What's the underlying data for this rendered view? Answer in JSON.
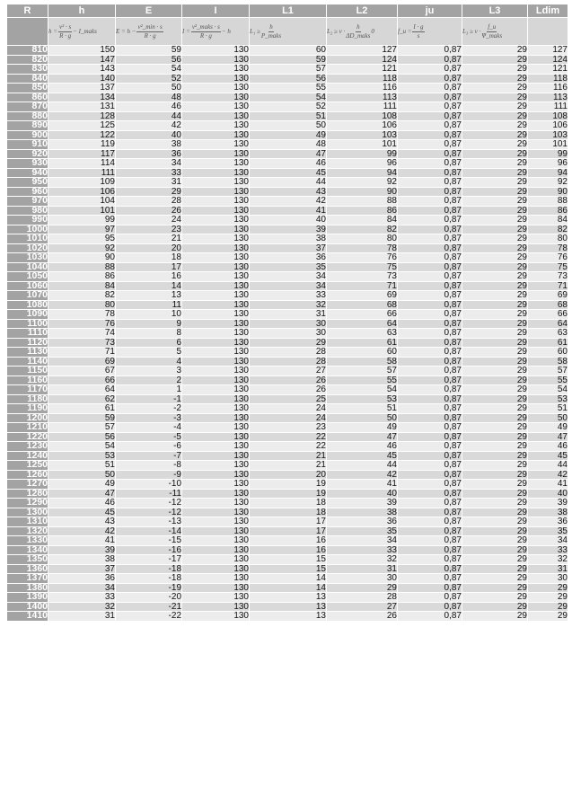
{
  "columns": [
    "R",
    "h",
    "E",
    "I",
    "L1",
    "L2",
    "ju",
    "L3",
    "Ldim"
  ],
  "formulas": {
    "h": {
      "lhs": "h =",
      "num": "v² · s",
      "den": "R · g",
      "rhs": "− I_maks"
    },
    "E": {
      "lhs": "E = h −",
      "num": "v²_min · s",
      "den": "R · g",
      "rhs": ""
    },
    "I": {
      "lhs": "I =",
      "num": "v²_maks · s",
      "den": "R · g",
      "rhs": "− h"
    },
    "L1": {
      "lhs": "L₁ ≥",
      "num": "h",
      "den": "P_maks",
      "rhs": ""
    },
    "L2": {
      "lhs": "L₂ ≥ v ·",
      "num": "h",
      "den": "ΔD_maks",
      "rhs": "0"
    },
    "ju": {
      "lhs": "f_u =",
      "num": "I · g",
      "den": "s",
      "rhs": ""
    },
    "L3": {
      "lhs": "L₃ ≥ v ·",
      "num": "f_u",
      "den": "Ψ_maks",
      "rhs": ""
    },
    "Ldim": null
  },
  "rows": [
    [
      "810",
      "150",
      "59",
      "130",
      "60",
      "127",
      "0,87",
      "29",
      "127"
    ],
    [
      "820",
      "147",
      "56",
      "130",
      "59",
      "124",
      "0,87",
      "29",
      "124"
    ],
    [
      "830",
      "143",
      "54",
      "130",
      "57",
      "121",
      "0,87",
      "29",
      "121"
    ],
    [
      "840",
      "140",
      "52",
      "130",
      "56",
      "118",
      "0,87",
      "29",
      "118"
    ],
    [
      "850",
      "137",
      "50",
      "130",
      "55",
      "116",
      "0,87",
      "29",
      "116"
    ],
    [
      "860",
      "134",
      "48",
      "130",
      "54",
      "113",
      "0,87",
      "29",
      "113"
    ],
    [
      "870",
      "131",
      "46",
      "130",
      "52",
      "111",
      "0,87",
      "29",
      "111"
    ],
    [
      "880",
      "128",
      "44",
      "130",
      "51",
      "108",
      "0,87",
      "29",
      "108"
    ],
    [
      "890",
      "125",
      "42",
      "130",
      "50",
      "106",
      "0,87",
      "29",
      "106"
    ],
    [
      "900",
      "122",
      "40",
      "130",
      "49",
      "103",
      "0,87",
      "29",
      "103"
    ],
    [
      "910",
      "119",
      "38",
      "130",
      "48",
      "101",
      "0,87",
      "29",
      "101"
    ],
    [
      "920",
      "117",
      "36",
      "130",
      "47",
      "99",
      "0,87",
      "29",
      "99"
    ],
    [
      "930",
      "114",
      "34",
      "130",
      "46",
      "96",
      "0,87",
      "29",
      "96"
    ],
    [
      "940",
      "111",
      "33",
      "130",
      "45",
      "94",
      "0,87",
      "29",
      "94"
    ],
    [
      "950",
      "109",
      "31",
      "130",
      "44",
      "92",
      "0,87",
      "29",
      "92"
    ],
    [
      "960",
      "106",
      "29",
      "130",
      "43",
      "90",
      "0,87",
      "29",
      "90"
    ],
    [
      "970",
      "104",
      "28",
      "130",
      "42",
      "88",
      "0,87",
      "29",
      "88"
    ],
    [
      "980",
      "101",
      "26",
      "130",
      "41",
      "86",
      "0,87",
      "29",
      "86"
    ],
    [
      "990",
      "99",
      "24",
      "130",
      "40",
      "84",
      "0,87",
      "29",
      "84"
    ],
    [
      "1000",
      "97",
      "23",
      "130",
      "39",
      "82",
      "0,87",
      "29",
      "82"
    ],
    [
      "1010",
      "95",
      "21",
      "130",
      "38",
      "80",
      "0,87",
      "29",
      "80"
    ],
    [
      "1020",
      "92",
      "20",
      "130",
      "37",
      "78",
      "0,87",
      "29",
      "78"
    ],
    [
      "1030",
      "90",
      "18",
      "130",
      "36",
      "76",
      "0,87",
      "29",
      "76"
    ],
    [
      "1040",
      "88",
      "17",
      "130",
      "35",
      "75",
      "0,87",
      "29",
      "75"
    ],
    [
      "1050",
      "86",
      "16",
      "130",
      "34",
      "73",
      "0,87",
      "29",
      "73"
    ],
    [
      "1060",
      "84",
      "14",
      "130",
      "34",
      "71",
      "0,87",
      "29",
      "71"
    ],
    [
      "1070",
      "82",
      "13",
      "130",
      "33",
      "69",
      "0,87",
      "29",
      "69"
    ],
    [
      "1080",
      "80",
      "11",
      "130",
      "32",
      "68",
      "0,87",
      "29",
      "68"
    ],
    [
      "1090",
      "78",
      "10",
      "130",
      "31",
      "66",
      "0,87",
      "29",
      "66"
    ],
    [
      "1100",
      "76",
      "9",
      "130",
      "30",
      "64",
      "0,87",
      "29",
      "64"
    ],
    [
      "1110",
      "74",
      "8",
      "130",
      "30",
      "63",
      "0,87",
      "29",
      "63"
    ],
    [
      "1120",
      "73",
      "6",
      "130",
      "29",
      "61",
      "0,87",
      "29",
      "61"
    ],
    [
      "1130",
      "71",
      "5",
      "130",
      "28",
      "60",
      "0,87",
      "29",
      "60"
    ],
    [
      "1140",
      "69",
      "4",
      "130",
      "28",
      "58",
      "0,87",
      "29",
      "58"
    ],
    [
      "1150",
      "67",
      "3",
      "130",
      "27",
      "57",
      "0,87",
      "29",
      "57"
    ],
    [
      "1160",
      "66",
      "2",
      "130",
      "26",
      "55",
      "0,87",
      "29",
      "55"
    ],
    [
      "1170",
      "64",
      "1",
      "130",
      "26",
      "54",
      "0,87",
      "29",
      "54"
    ],
    [
      "1180",
      "62",
      "-1",
      "130",
      "25",
      "53",
      "0,87",
      "29",
      "53"
    ],
    [
      "1190",
      "61",
      "-2",
      "130",
      "24",
      "51",
      "0,87",
      "29",
      "51"
    ],
    [
      "1200",
      "59",
      "-3",
      "130",
      "24",
      "50",
      "0,87",
      "29",
      "50"
    ],
    [
      "1210",
      "57",
      "-4",
      "130",
      "23",
      "49",
      "0,87",
      "29",
      "49"
    ],
    [
      "1220",
      "56",
      "-5",
      "130",
      "22",
      "47",
      "0,87",
      "29",
      "47"
    ],
    [
      "1230",
      "54",
      "-6",
      "130",
      "22",
      "46",
      "0,87",
      "29",
      "46"
    ],
    [
      "1240",
      "53",
      "-7",
      "130",
      "21",
      "45",
      "0,87",
      "29",
      "45"
    ],
    [
      "1250",
      "51",
      "-8",
      "130",
      "21",
      "44",
      "0,87",
      "29",
      "44"
    ],
    [
      "1260",
      "50",
      "-9",
      "130",
      "20",
      "42",
      "0,87",
      "29",
      "42"
    ],
    [
      "1270",
      "49",
      "-10",
      "130",
      "19",
      "41",
      "0,87",
      "29",
      "41"
    ],
    [
      "1280",
      "47",
      "-11",
      "130",
      "19",
      "40",
      "0,87",
      "29",
      "40"
    ],
    [
      "1290",
      "46",
      "-12",
      "130",
      "18",
      "39",
      "0,87",
      "29",
      "39"
    ],
    [
      "1300",
      "45",
      "-12",
      "130",
      "18",
      "38",
      "0,87",
      "29",
      "38"
    ],
    [
      "1310",
      "43",
      "-13",
      "130",
      "17",
      "36",
      "0,87",
      "29",
      "36"
    ],
    [
      "1320",
      "42",
      "-14",
      "130",
      "17",
      "35",
      "0,87",
      "29",
      "35"
    ],
    [
      "1330",
      "41",
      "-15",
      "130",
      "16",
      "34",
      "0,87",
      "29",
      "34"
    ],
    [
      "1340",
      "39",
      "-16",
      "130",
      "16",
      "33",
      "0,87",
      "29",
      "33"
    ],
    [
      "1350",
      "38",
      "-17",
      "130",
      "15",
      "32",
      "0,87",
      "29",
      "32"
    ],
    [
      "1360",
      "37",
      "-18",
      "130",
      "15",
      "31",
      "0,87",
      "29",
      "31"
    ],
    [
      "1370",
      "36",
      "-18",
      "130",
      "14",
      "30",
      "0,87",
      "29",
      "30"
    ],
    [
      "1380",
      "34",
      "-19",
      "130",
      "14",
      "29",
      "0,87",
      "29",
      "29"
    ],
    [
      "1390",
      "33",
      "-20",
      "130",
      "13",
      "28",
      "0,87",
      "29",
      "29"
    ],
    [
      "1400",
      "32",
      "-21",
      "130",
      "13",
      "27",
      "0,87",
      "29",
      "29"
    ],
    [
      "1410",
      "31",
      "-22",
      "130",
      "13",
      "26",
      "0,87",
      "29",
      "29"
    ]
  ]
}
